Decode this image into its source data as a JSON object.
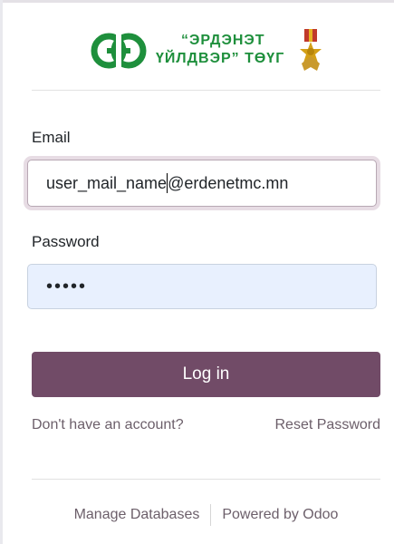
{
  "brand": {
    "line1": "“ЭРДЭНЭТ",
    "line2": "ҮЙЛДВЭР” ТӨҮГ",
    "logo_icon": "erdenet-logo-icon",
    "medal_icon": "medal-icon",
    "brand_color": "#1e8f3c"
  },
  "form": {
    "email_label": "Email",
    "email_value_before_caret": "user_mail_name",
    "email_value_after_caret": "@erdenetmc.mn",
    "password_label": "Password",
    "password_value": "•••••",
    "login_label": "Log in"
  },
  "links": {
    "signup": "Don't have an account?",
    "reset": "Reset Password"
  },
  "footer": {
    "manage_databases": "Manage Databases",
    "powered_by": "Powered by Odoo"
  },
  "colors": {
    "primary": "#714b67",
    "link": "#6c5f6a",
    "autofill": "#e8f0fe"
  }
}
